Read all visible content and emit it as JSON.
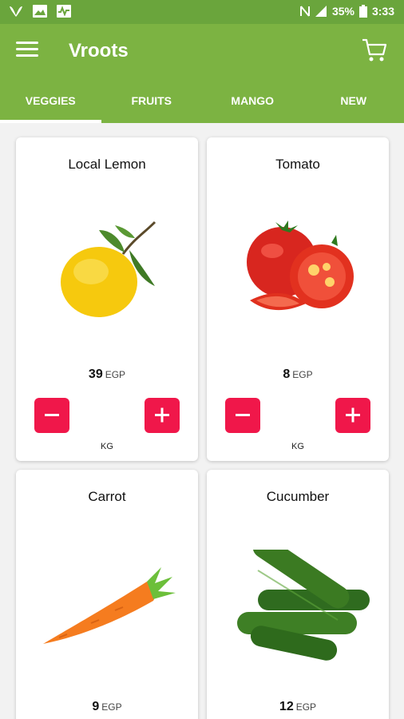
{
  "status_bar": {
    "battery": "35%",
    "time": "3:33"
  },
  "app": {
    "title": "Vroots"
  },
  "tabs": [
    {
      "label": "VEGGIES",
      "active": true
    },
    {
      "label": "FRUITS",
      "active": false
    },
    {
      "label": "MANGO",
      "active": false
    },
    {
      "label": "NEW",
      "active": false
    }
  ],
  "products": [
    {
      "name": "Local Lemon",
      "price": "39",
      "currency": "EGP",
      "unit": "KG",
      "image": "lemon"
    },
    {
      "name": "Tomato",
      "price": "8",
      "currency": "EGP",
      "unit": "KG",
      "image": "tomato"
    },
    {
      "name": "Carrot",
      "price": "9",
      "currency": "EGP",
      "image": "carrot"
    },
    {
      "name": "Cucumber",
      "price": "12",
      "currency": "EGP",
      "image": "cucumber"
    }
  ],
  "colors": {
    "primary": "#7cb342",
    "status_bar": "#6aa53c",
    "accent": "#f0174a"
  },
  "icons": {
    "menu": "hamburger-icon",
    "cart": "cart-icon",
    "minus": "minus-icon",
    "plus": "plus-icon"
  }
}
